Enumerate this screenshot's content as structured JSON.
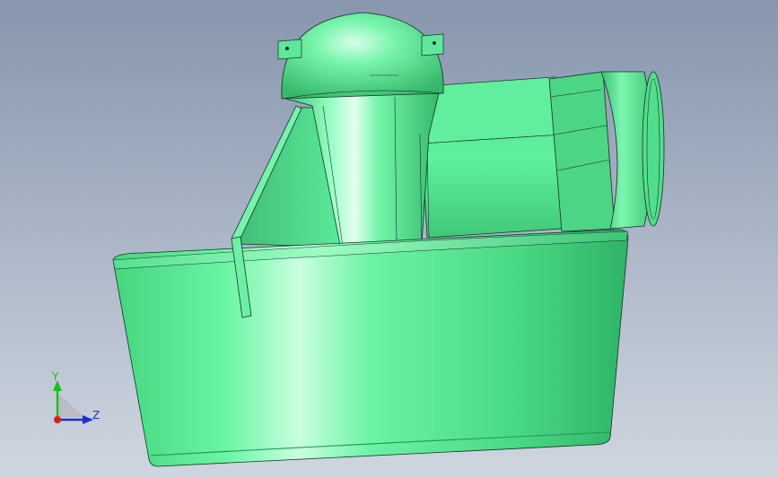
{
  "viewport": {
    "background_top": "#8796ad",
    "background_bottom": "#cfd6e0"
  },
  "model": {
    "surface_color": "#5df29a",
    "shade_color": "#2fb367",
    "highlight_color": "#c9ffe0",
    "edge_color": "#123322"
  },
  "triad": {
    "y_label": "Y",
    "z_label": "Z",
    "y_color": "#19c01c",
    "z_color": "#1a2fd6",
    "x_color": "#e01b1b",
    "plane_color": "#b9b9c0"
  }
}
